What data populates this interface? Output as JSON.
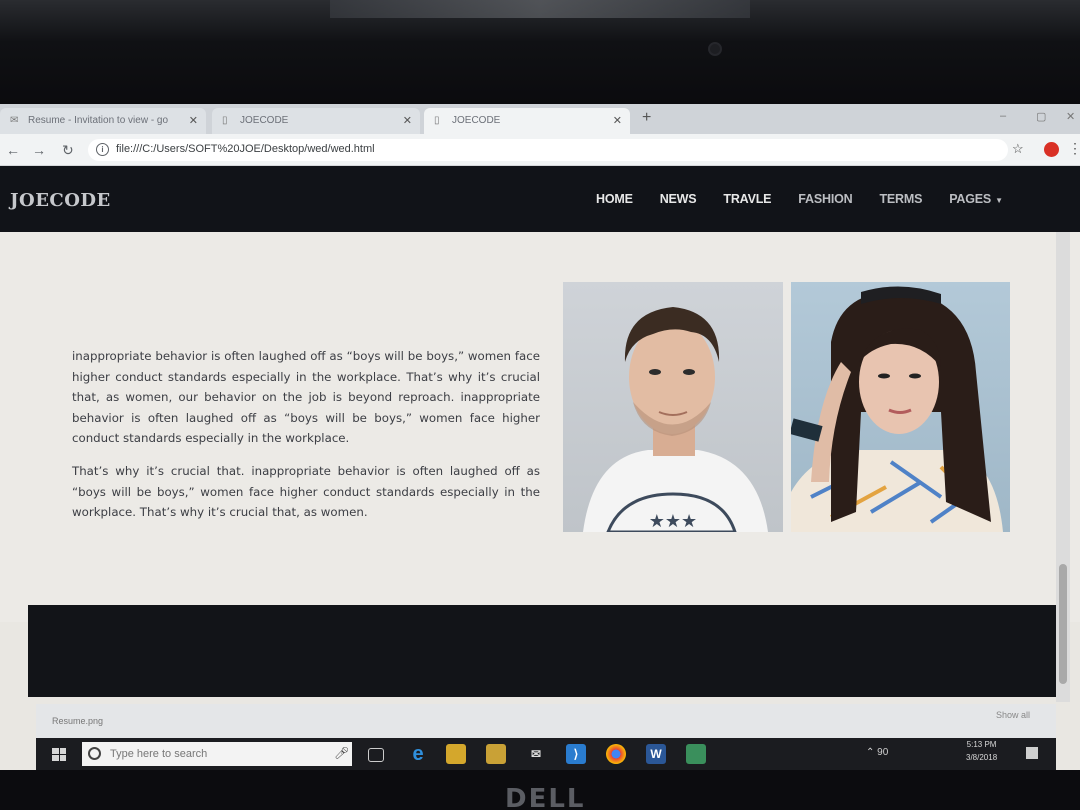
{
  "browser": {
    "tabs": [
      {
        "label": "Resume - Invitation to view - go",
        "active": false
      },
      {
        "label": "JOECODE",
        "active": false
      },
      {
        "label": "JOECODE",
        "active": true
      }
    ],
    "new_tab": "+",
    "url": "file:///C:/Users/SOFT%20JOE/Desktop/wed/wed.html"
  },
  "site": {
    "brand": "JOECODE",
    "nav": [
      "HOME",
      "NEWS",
      "TRAVLE",
      "FASHION",
      "TERMS",
      "PAGES"
    ],
    "paragraphs": [
      "inappropriate behavior is often laughed off as “boys will be boys,” women face higher conduct standards especially in the workplace. That’s why it’s crucial that, as women, our behavior on the job is beyond reproach. inappropriate behavior is often laughed off as “boys will be boys,” women face higher conduct standards especially in the workplace.",
      "That’s why it’s crucial that. inappropriate behavior is often laughed off as “boys will be boys,” women face higher conduct standards especially in the workplace. That’s why it’s crucial that, as women."
    ]
  },
  "downloads": {
    "item": "Resume.png",
    "show_all": "Show all"
  },
  "taskbar": {
    "search_placeholder": "Type here to search",
    "time": "5:13 PM",
    "date": "3/8/2018",
    "tray_text": "90"
  },
  "hardware": {
    "brand_logo": "DELL"
  }
}
